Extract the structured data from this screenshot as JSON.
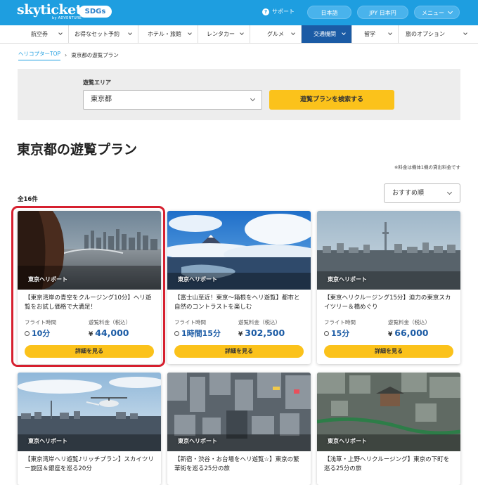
{
  "header": {
    "logo_main": "skyticket",
    "logo_sub": "by ADVENTURE",
    "sdgs_label": "SDGs",
    "support_label": "サポート",
    "language_label": "日本語",
    "currency_label": "JPY 日本円",
    "menu_label": "メニュー",
    "brand_color": "#1e9ee0"
  },
  "nav": {
    "items": [
      {
        "label": "航空券"
      },
      {
        "label": "お得なセット予約"
      },
      {
        "label": "ホテル・旅館"
      },
      {
        "label": "レンタカー"
      },
      {
        "label": "グルメ"
      },
      {
        "label": "交通機関",
        "active": true
      },
      {
        "label": "留学"
      },
      {
        "label": "旅のオプション"
      }
    ]
  },
  "breadcrumb": {
    "parent": "ヘリコプターTOP",
    "current": "東京都の遊覧プラン"
  },
  "search": {
    "area_label": "遊覧エリア",
    "area_value": "東京都",
    "button_label": "遊覧プランを検索する"
  },
  "page": {
    "heading": "東京都の遊覧プラン",
    "fee_note": "※料金は機体1機の貸出料金です",
    "result_count": "全16件",
    "sort_value": "おすすめ順"
  },
  "cards": [
    {
      "tag": "東京ヘリポート",
      "title": "【東京湾岸の青空をクルージング10分】ヘリ遊覧をお試し価格で大満足！",
      "flight_label": "フライト時間",
      "flight_value": "10分",
      "price_label": "遊覧料金（税込）",
      "price_currency": "¥",
      "price_value": "44,000",
      "button_label": "詳細を見る"
    },
    {
      "tag": "東京ヘリポート",
      "title": "【富士山至近！東京～箱根をヘリ遊覧】都市と自然のコントラストを楽しむ",
      "flight_label": "フライト時間",
      "flight_value": "1時間15分",
      "price_label": "遊覧料金（税込）",
      "price_currency": "¥",
      "price_value": "302,500",
      "button_label": "詳細を見る"
    },
    {
      "tag": "東京ヘリポート",
      "title": "【東京ヘリクルージング15分】迫力の東京スカイツリー＆橋めぐり",
      "flight_label": "フライト時間",
      "flight_value": "15分",
      "price_label": "遊覧料金（税込）",
      "price_currency": "¥",
      "price_value": "66,000",
      "button_label": "詳細を見る"
    },
    {
      "tag": "東京ヘリポート",
      "title": "【東京湾岸ヘリ遊覧♪リッチプラン】スカイツリー旋回＆銀座を巡る20分"
    },
    {
      "tag": "東京ヘリポート",
      "title": "【新宿・渋谷・お台場をヘリ遊覧☆】東京の繁華街を巡る25分の旅"
    },
    {
      "tag": "東京ヘリポート",
      "title": "【浅草・上野ヘリクルージング】東京の下町を巡る25分の旅"
    }
  ],
  "colors": {
    "accent_yellow": "#fbc21b",
    "price_blue": "#1b5ba5",
    "highlight_red": "#d6202f"
  }
}
